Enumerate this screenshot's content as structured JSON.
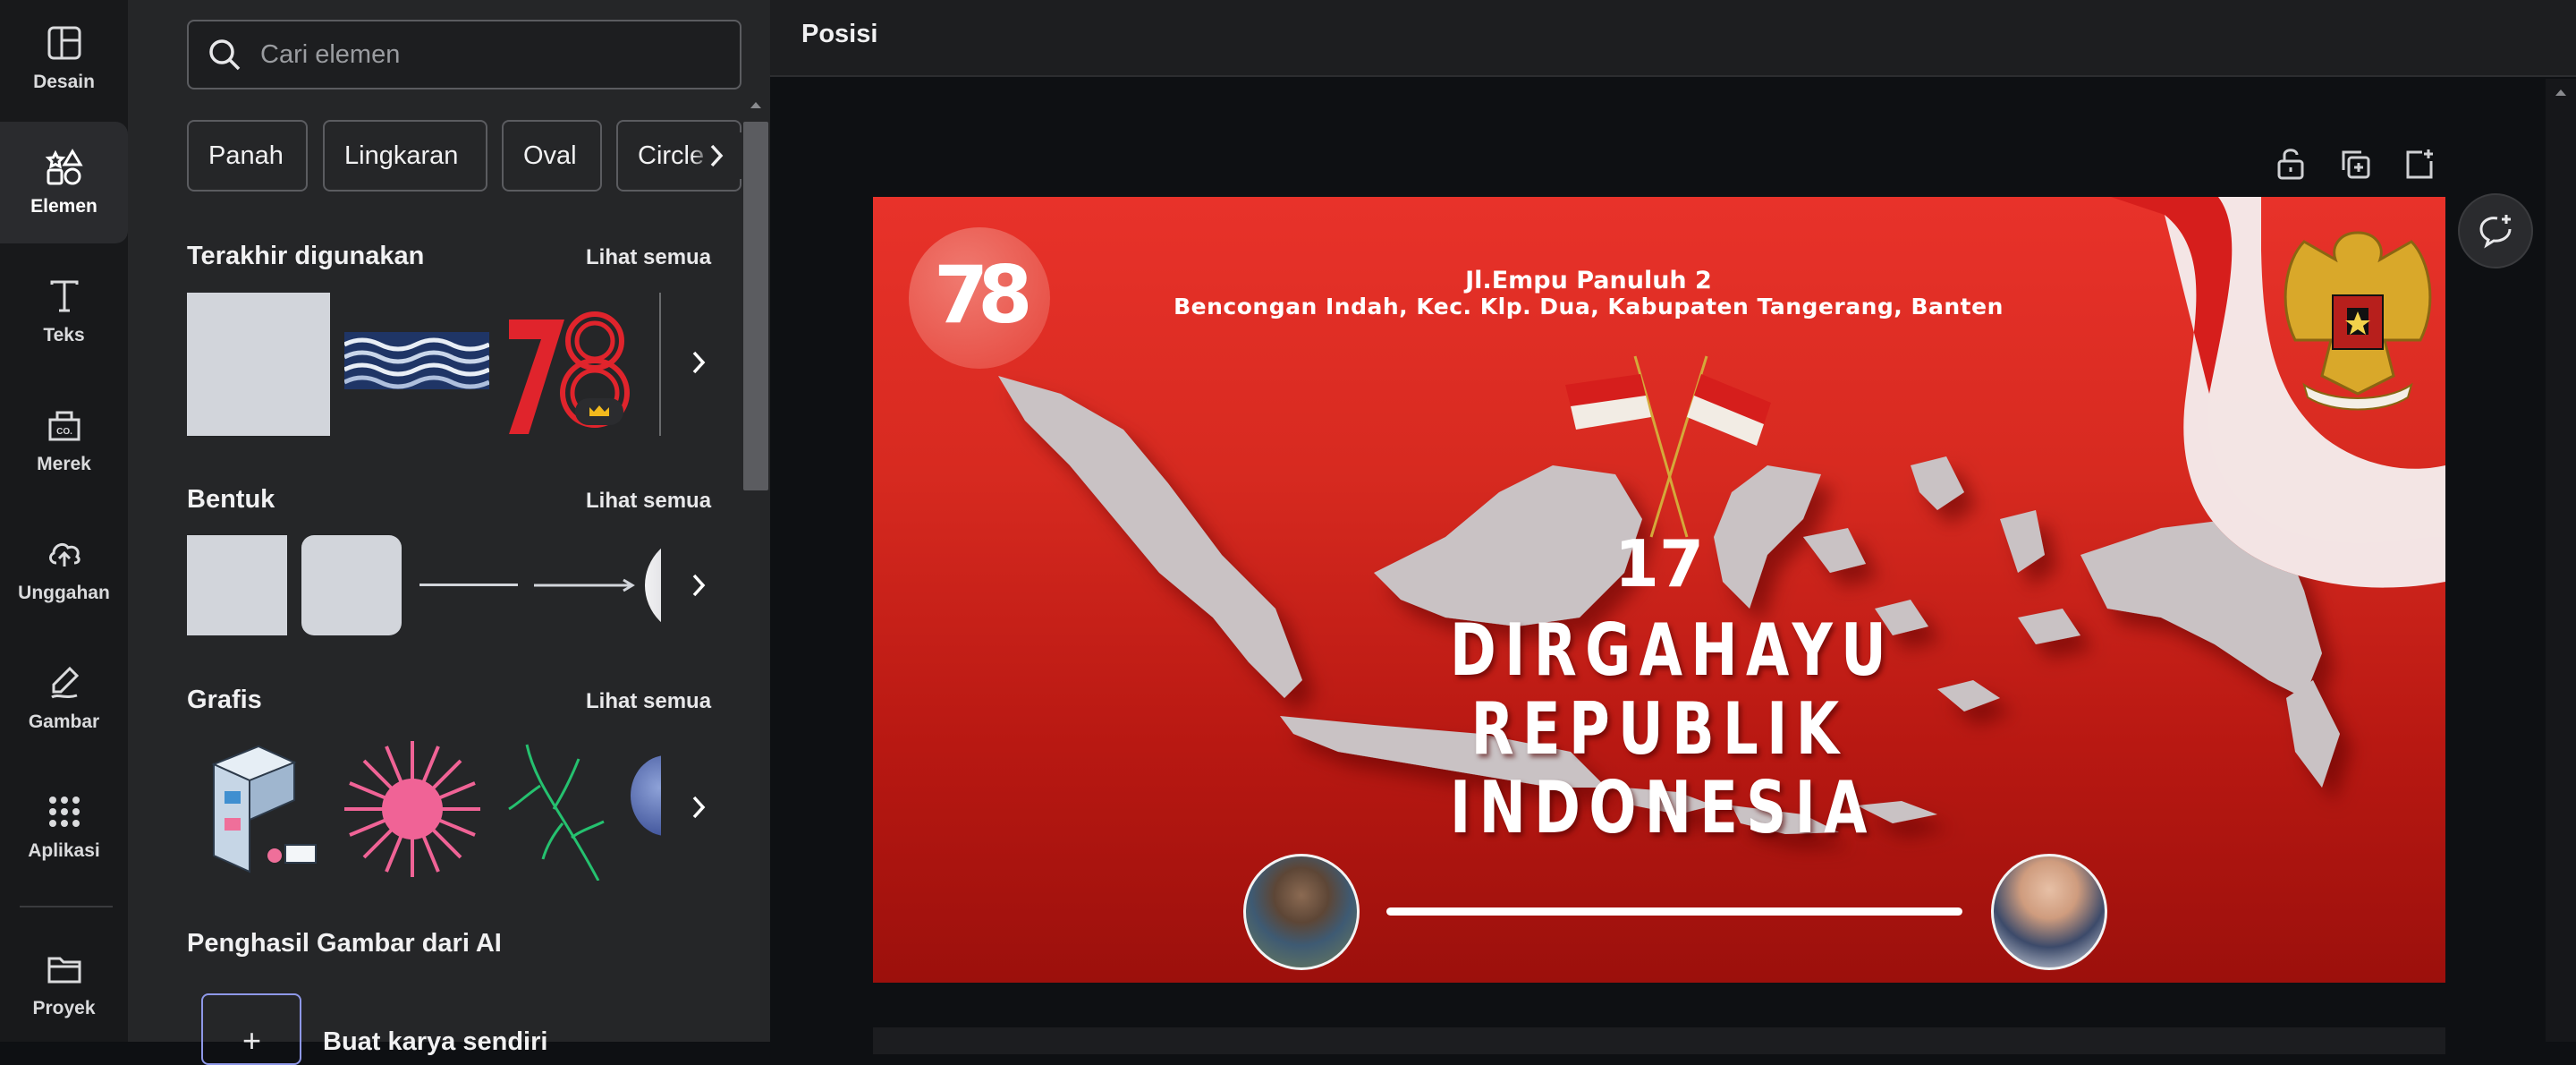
{
  "rail": {
    "items": [
      {
        "label": "Desain",
        "icon": "layout-icon"
      },
      {
        "label": "Elemen",
        "icon": "shapes-icon"
      },
      {
        "label": "Teks",
        "icon": "text-icon"
      },
      {
        "label": "Merek",
        "icon": "brand-icon"
      },
      {
        "label": "Unggahan",
        "icon": "upload-cloud-icon"
      },
      {
        "label": "Gambar",
        "icon": "draw-icon"
      },
      {
        "label": "Aplikasi",
        "icon": "apps-grid-icon"
      },
      {
        "label": "Proyek",
        "icon": "folder-icon"
      }
    ],
    "active": "Elemen"
  },
  "panel": {
    "search_placeholder": "Cari elemen",
    "chips": [
      "Panah",
      "Lingkaran",
      "Oval",
      "Circle"
    ],
    "sections": {
      "recent": {
        "title": "Terakhir digunakan",
        "link": "Lihat semua"
      },
      "shapes": {
        "title": "Bentuk",
        "link": "Lihat semua"
      },
      "graphics": {
        "title": "Grafis",
        "link": "Lihat semua"
      },
      "ai": {
        "title": "Penghasil Gambar dari AI",
        "create_label": "Buat karya sendiri"
      }
    }
  },
  "topbar": {
    "title": "Posisi"
  },
  "poster": {
    "address_line1": "Jl.Empu Panuluh 2",
    "address_line2": "Bencongan Indah, Kec. Klp. Dua, Kabupaten Tangerang, Banten",
    "logo_text": "78",
    "number": "17",
    "headline1": "DIRGAHAYU",
    "headline2": "REPUBLIK",
    "headline3": "INDONESIA"
  },
  "colors": {
    "accent_red": "#e3261f",
    "map_gray": "#c9c2c4",
    "rail_bg": "#18191b",
    "panel_bg": "#252628"
  }
}
